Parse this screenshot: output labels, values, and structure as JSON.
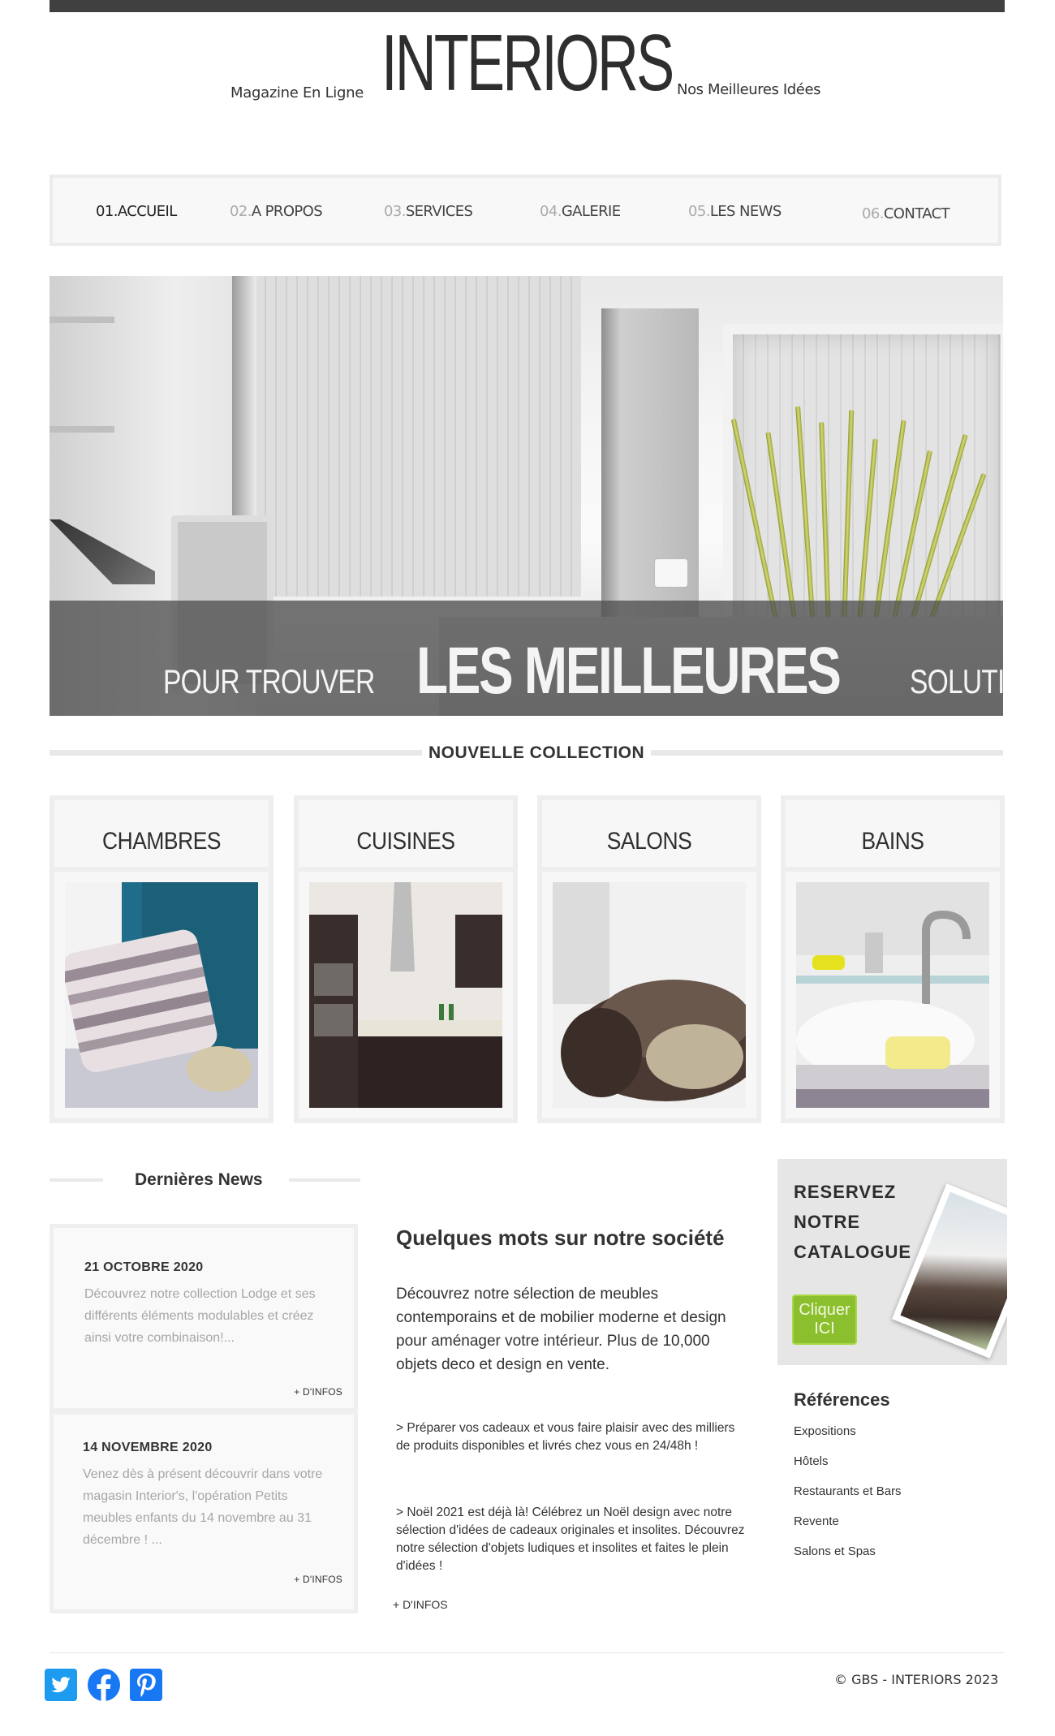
{
  "header": {
    "tagline_left": "Magazine En Ligne",
    "logo": "INTERIORS",
    "tagline_right": "Nos Meilleures Idées"
  },
  "nav": {
    "items": [
      {
        "num": "01.",
        "label": "ACCUEIL",
        "active": true
      },
      {
        "num": "02.",
        "label": "A PROPOS"
      },
      {
        "num": "03.",
        "label": "SERVICES"
      },
      {
        "num": "04.",
        "label": "GALERIE"
      },
      {
        "num": "05.",
        "label": "LES NEWS"
      },
      {
        "num": "06.",
        "label": "CONTACT"
      }
    ]
  },
  "hero": {
    "caption_small_left": "POUR TROUVER",
    "caption_big": "LES MEILLEURES",
    "caption_small_right": "SOLUTIONS..."
  },
  "collection": {
    "heading": "NOUVELLE COLLECTION",
    "cards": [
      {
        "title": "CHAMBRES"
      },
      {
        "title": "CUISINES"
      },
      {
        "title": "SALONS"
      },
      {
        "title": "BAINS"
      }
    ]
  },
  "news": {
    "heading": "Dernières News",
    "items": [
      {
        "date": "21 OCTOBRE 2020",
        "text": "Découvrez notre collection Lodge et ses différents éléments modulables et créez ainsi votre combinaison!...",
        "more": "+ D'INFOS"
      },
      {
        "date": "14 NOVEMBRE 2020",
        "text": "Venez dès à présent découvrir dans votre magasin Interior's, l'opération Petits meubles enfants du 14 novembre au 31 décembre ! ...",
        "more": "+ D'INFOS"
      }
    ]
  },
  "about": {
    "title": "Quelques mots sur notre société",
    "lead": "Découvrez notre sélection de meubles contemporains et de mobilier moderne et design pour aménager votre intérieur. Plus de 10,000 objets deco et design en vente.",
    "p1": "> Préparer vos cadeaux et vous faire plaisir avec des milliers de produits disponibles et livrés chez vous en 24/48h !",
    "p2": "> Noël 2021 est déjà là! Célébrez un Noël design avec notre sélection d'idées de cadeaux originales et insolites.  Découvrez notre sélection d'objets ludiques et insolites et faites le plein d'idées !",
    "more": "+ D'INFOS"
  },
  "catalog": {
    "line1": "RESERVEZ",
    "line2": "NOTRE",
    "line3": "CATALOGUE",
    "button_line1": "Cliquer",
    "button_line2": "ICI",
    "button_color": "#8cbf2d"
  },
  "references": {
    "title": "Références",
    "items": [
      "Expositions",
      "Hôtels",
      "Restaurants et Bars",
      "Revente",
      "Salons et Spas"
    ]
  },
  "footer": {
    "social": [
      {
        "icon": "twitter-icon",
        "color": "#1d9bf0"
      },
      {
        "icon": "facebook-icon",
        "color": "#1877f2"
      },
      {
        "icon": "pinterest-icon",
        "color": "#1877f2"
      }
    ],
    "copyright": "© GBS - INTERIORS 2023"
  }
}
